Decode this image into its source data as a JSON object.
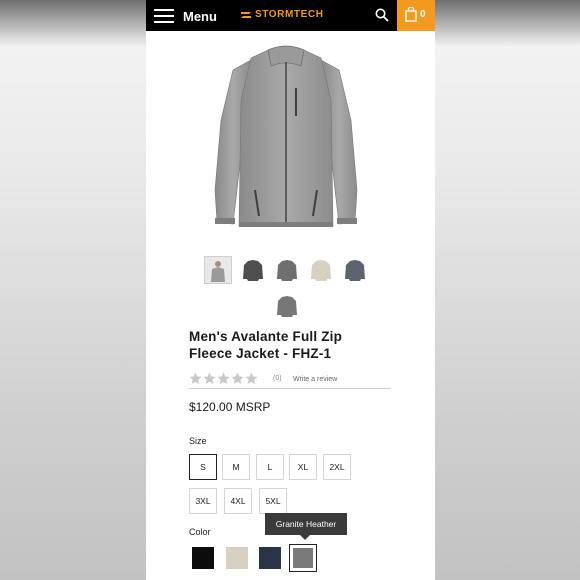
{
  "header": {
    "menu_label": "Menu",
    "brand": "STORMTECH",
    "cart_count": "0",
    "brand_color": "#f39a1e"
  },
  "gallery": {
    "thumbnails": [
      {
        "name": "model-front",
        "color": "#9a9a9a"
      },
      {
        "name": "charcoal",
        "color": "#4e4e4e"
      },
      {
        "name": "granite",
        "color": "#6f6f6f"
      },
      {
        "name": "oatmeal",
        "color": "#d8d0c0"
      },
      {
        "name": "navy",
        "color": "#5c6470"
      },
      {
        "name": "granite-alt",
        "color": "#777777"
      }
    ]
  },
  "product": {
    "title_line1": "Men's Avalante Full Zip",
    "title_line2": "Fleece Jacket - FHZ-1",
    "rating_count": "(0)",
    "write_review": "Write a review",
    "price": "$120.00 MSRP"
  },
  "size": {
    "label": "Size",
    "options": [
      "S",
      "M",
      "L",
      "XL",
      "2XL",
      "3XL",
      "4XL",
      "5XL"
    ],
    "selected": "S"
  },
  "color": {
    "label": "Color",
    "tooltip": "Granite Heather",
    "swatches": [
      {
        "name": "black",
        "color": "#0c0c0c"
      },
      {
        "name": "oatmeal-heather",
        "color": "#d9cfc2"
      },
      {
        "name": "navy-heather",
        "color": "#2a3447"
      },
      {
        "name": "granite-heather",
        "color": "#7a7a7a"
      }
    ],
    "selected": "Granite Heather"
  }
}
